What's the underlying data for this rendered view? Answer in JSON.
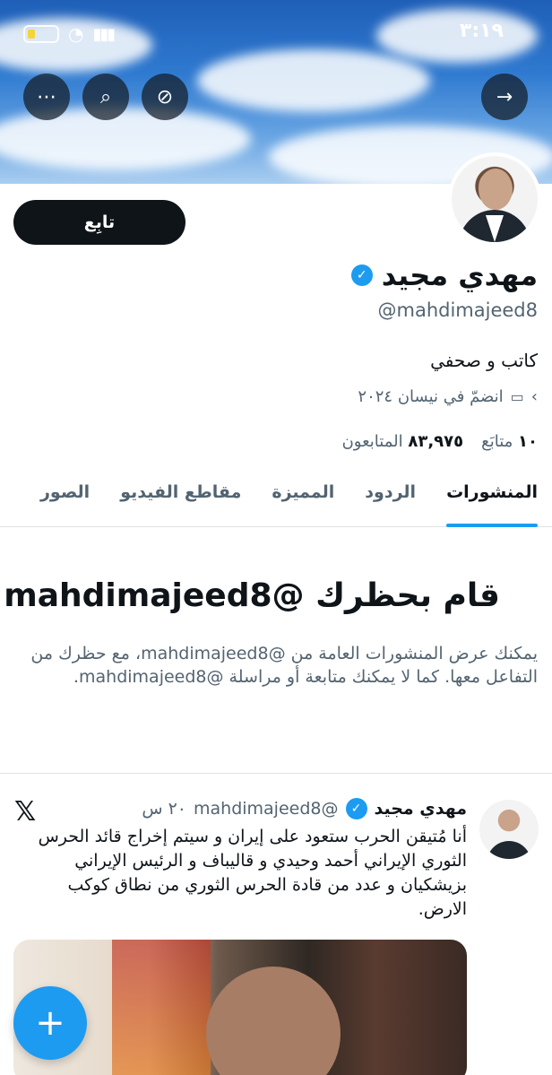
{
  "status_bar": {
    "time": "٣:١٩"
  },
  "banner_buttons": {
    "more": "⋯",
    "search": "⌕",
    "share": "⊘",
    "forward": "→"
  },
  "profile": {
    "follow_label": "تابِع",
    "name": "مهدي مجيد",
    "handle": "@mahdimajeed8",
    "bio": "كاتب و صحفي",
    "joined": "انضمّ في نيسان ٢٠٢٤",
    "following_count": "١٠",
    "following_label": "متابَع",
    "followers_count": "٨٣,٩٧٥",
    "followers_label": "المتابعون"
  },
  "tabs": [
    "المنشورات",
    "الردود",
    "المميزة",
    "مقاطع الفيديو",
    "الصور"
  ],
  "blocked": {
    "title": "قام بحظرك @mahdimajeed8",
    "text": "يمكنك عرض المنشورات العامة من @mahdimajeed8، مع حظرك من التفاعل معها. كما لا يمكنك متابعة أو مراسلة @mahdimajeed8."
  },
  "post": {
    "name": "مهدي مجيد",
    "handle": "@mahdimajeed8",
    "time": "٢٠ س",
    "text": "أنا مُتيقن الحرب ستعود على إيران و سيتم إخراج قائد الحرس الثوري الإيراني أحمد وحيدي و قاليباف و الرئيس الإيراني بزيشكيان و عدد من قادة الحرس الثوري من نطاق كوكب الارض."
  },
  "fab_label": "+",
  "colors": {
    "accent": "#1d9bf0",
    "text": "#0f1419",
    "secondary": "#536471"
  }
}
